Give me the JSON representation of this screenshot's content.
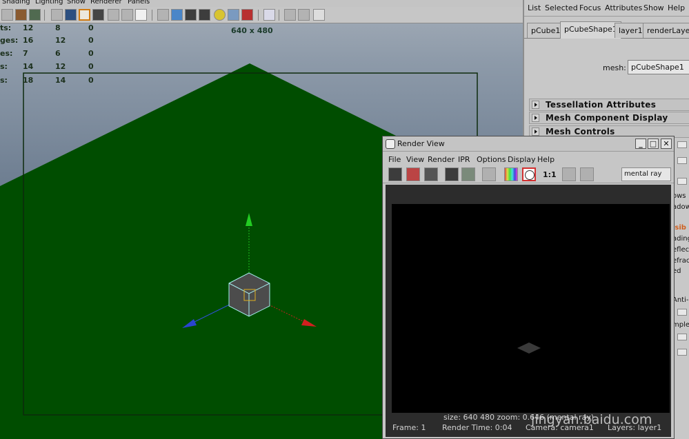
{
  "viewport": {
    "menu": [
      "Shading",
      "Lighting",
      "Show",
      "Renderer",
      "Panels"
    ],
    "resolution_gate": "640 x 480",
    "hud_rows": [
      {
        "label": "ts:",
        "a": "12",
        "b": "8",
        "c": "0"
      },
      {
        "label": "ges:",
        "a": "16",
        "b": "12",
        "c": "0"
      },
      {
        "label": "es:",
        "a": "7",
        "b": "6",
        "c": "0"
      },
      {
        "label": "s:",
        "a": "14",
        "b": "12",
        "c": "0"
      },
      {
        "label": "s:",
        "a": "18",
        "b": "14",
        "c": "0"
      }
    ],
    "colors": {
      "ground": "#004d00",
      "cube": "#4c4c4c",
      "wire": "#a8f0f0"
    }
  },
  "attribute_editor": {
    "menu": [
      "List",
      "Selected",
      "Focus",
      "Attributes",
      "Show",
      "Help"
    ],
    "tabs": [
      "pCube1",
      "pCubeShape1",
      "layer1",
      "renderLayerM"
    ],
    "active_tab": "pCubeShape1",
    "mesh_label": "mesh:",
    "mesh_value": "pCubeShape1",
    "sections": [
      "Tessellation Attributes",
      "Mesh Component Display",
      "Mesh Controls"
    ],
    "partial_labels": [
      "ows",
      "adow",
      "isib",
      "ading",
      "eflec",
      "efrac",
      "ed",
      "Anti-a",
      "mple"
    ]
  },
  "render_view": {
    "title": "Render View",
    "window_buttons": [
      "_",
      "□",
      "✕"
    ],
    "menu": [
      "File",
      "View",
      "Render",
      "IPR",
      "Options",
      "Display",
      "Help"
    ],
    "ratio_label": "1:1",
    "renderer": "mental ray",
    "info": {
      "size": "size:  640  480 zoom: 0.646     (mental ray)",
      "frame": "Frame: 1",
      "render_time": "Render Time: 0:04",
      "camera": "Camera: camera1",
      "layers": "Layers: layer1"
    }
  },
  "watermark": "jingyan.baidu.com"
}
